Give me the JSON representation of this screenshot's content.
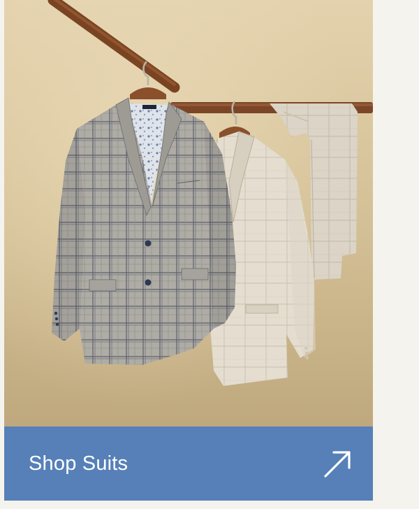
{
  "promo": {
    "image_subject": "suits-on-hangers",
    "cta_label": "Shop Suits",
    "cta_icon": "arrow-up-right-icon",
    "colors": {
      "page_background": "#f4f3ee",
      "backdrop": "#d2bf98",
      "cta_background": "#5680b7",
      "cta_text": "#ffffff"
    }
  }
}
